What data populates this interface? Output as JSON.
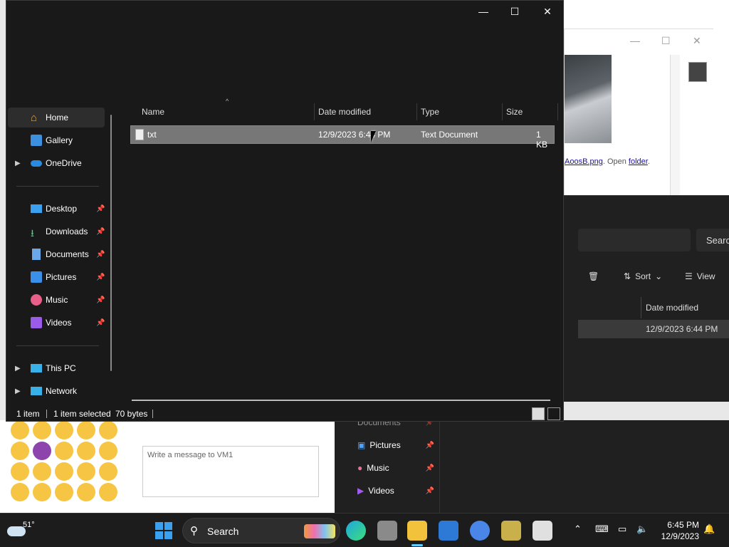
{
  "explorer": {
    "controls": {
      "minimize": "—",
      "maximize": "☐",
      "close": "✕"
    },
    "nav": {
      "home": "Home",
      "gallery": "Gallery",
      "onedrive": "OneDrive",
      "desktop": "Desktop",
      "downloads": "Downloads",
      "documents": "Documents",
      "pictures": "Pictures",
      "music": "Music",
      "videos": "Videos",
      "this_pc": "This PC",
      "network": "Network"
    },
    "columns": {
      "name": "Name",
      "date": "Date modified",
      "type": "Type",
      "size": "Size"
    },
    "file": {
      "name": "txt",
      "date": "12/9/2023 6:44 PM",
      "type": "Text Document",
      "size": "1 KB"
    },
    "status": {
      "count": "1 item",
      "selected": "1 item selected",
      "bytes": "70 bytes"
    }
  },
  "background": {
    "image_link_prefix": "AoosB.png",
    "image_open_text": ". Open ",
    "image_folder": "folder",
    "image_period": ".",
    "search_button": "Searc",
    "sort": "Sort",
    "view": "View",
    "date_col": "Date modified",
    "row_date": "12/9/2023 6:44 PM",
    "chat_placeholder": "Write a message to VM1",
    "nav": {
      "documents": "Documents",
      "pictures": "Pictures",
      "music": "Music",
      "videos": "Videos"
    }
  },
  "taskbar": {
    "temperature": "51°",
    "search": "Search",
    "time": "6:45 PM",
    "date": "12/9/2023"
  },
  "colors": {
    "accent": "#60cdff",
    "selection": "#777777",
    "window_bg": "#191919"
  }
}
